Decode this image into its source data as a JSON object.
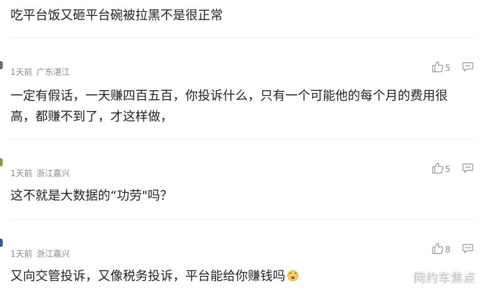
{
  "colors": {
    "text": "#222222",
    "meta": "#888888",
    "divider": "#eeeeee",
    "icon": "#999999"
  },
  "comments": [
    {
      "text": "吃平台饭又砸平台碗被拉黑不是很正常"
    },
    {
      "time": "1天前",
      "location": "广东湛江",
      "likes": "5",
      "text": "一定有假话，一天赚四百五百，你投诉什么，只有一个可能他的每个月的费用很高，都赚不到了，才这样做，",
      "avatar_icon": "avatar-icon"
    },
    {
      "time": "1天前",
      "location": "浙江嘉兴",
      "likes": "5",
      "text": "这不就是大数据的“功劳\"吗？",
      "avatar_icon": "avatar-icon"
    },
    {
      "time": "1天前",
      "location": "浙江嘉兴",
      "likes": "8",
      "text": "又向交管投诉，又像税务投诉，平台能给你赚钱吗",
      "emoji": "emoji-icon",
      "avatar_icon": "avatar-icon"
    }
  ],
  "watermark": "网约车焦点"
}
